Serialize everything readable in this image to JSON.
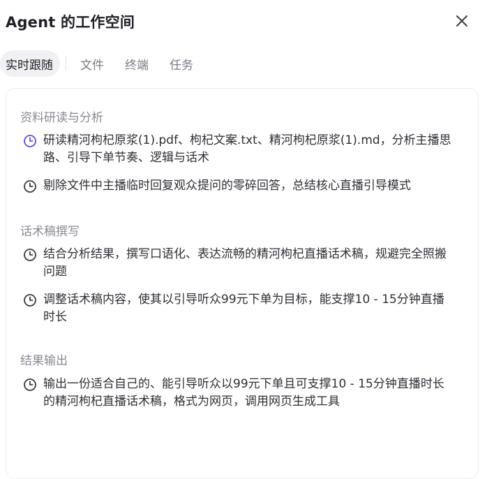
{
  "header": {
    "title": "Agent 的工作空间"
  },
  "tabs": [
    {
      "label": "实时跟随",
      "active": true
    },
    {
      "label": "文件",
      "active": false
    },
    {
      "label": "终端",
      "active": false
    },
    {
      "label": "任务",
      "active": false
    }
  ],
  "sections": [
    {
      "title": "资料研读与分析",
      "tasks": [
        {
          "text": "研读精河枸杞原浆(1).pdf、枸杞文案.txt、精河枸杞原浆(1).md，分析主播思路、引导下单节奏、逻辑与话术",
          "status": "active"
        },
        {
          "text": "剔除文件中主播临时回复观众提问的零碎回答，总结核心直播引导模式",
          "status": "pending"
        }
      ]
    },
    {
      "title": "话术稿撰写",
      "tasks": [
        {
          "text": "结合分析结果，撰写口语化、表达流畅的精河枸杞直播话术稿，规避完全照搬问题",
          "status": "pending"
        },
        {
          "text": "调整话术稿内容，使其以引导听众99元下单为目标，能支撑10 - 15分钟直播时长",
          "status": "pending"
        }
      ]
    },
    {
      "title": "结果输出",
      "tasks": [
        {
          "text": "输出一份适合自己的、能引导听众以99元下单且可支撑10 - 15分钟直播时长的精河枸杞直播话术稿，格式为网页，调用网页生成工具",
          "status": "pending"
        }
      ]
    }
  ],
  "colors": {
    "active_icon": "#5b4fe0",
    "pending_icon": "#3a3a42",
    "section_title": "#8a8a94"
  },
  "icons": {
    "close": "close-icon",
    "task_status": "clock-icon"
  }
}
